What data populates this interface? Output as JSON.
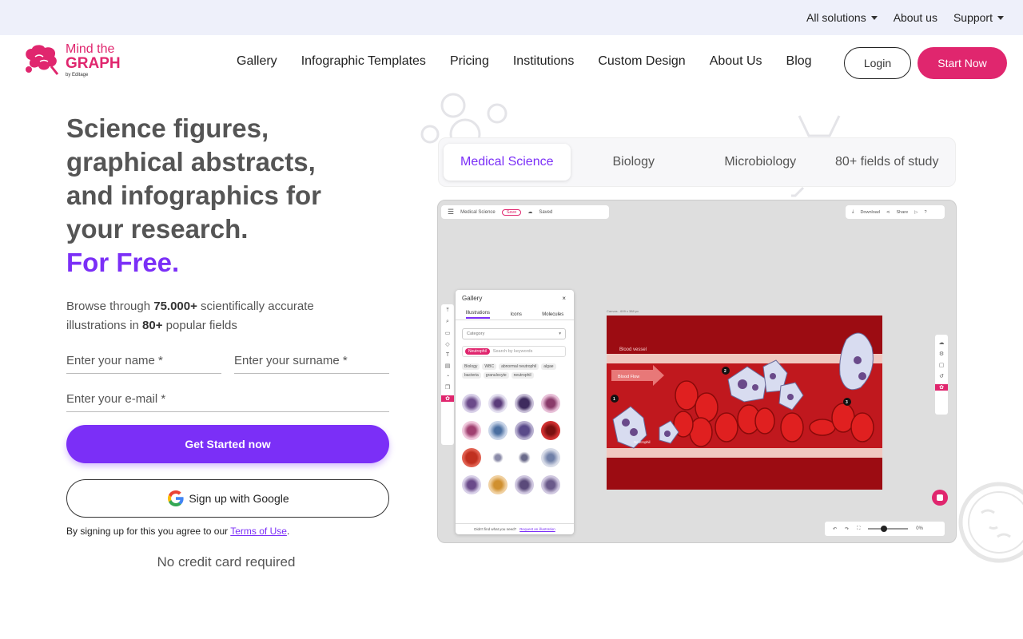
{
  "topbar": {
    "items": [
      {
        "label": "All solutions",
        "has_caret": true
      },
      {
        "label": "About us",
        "has_caret": false
      },
      {
        "label": "Support",
        "has_caret": true
      }
    ]
  },
  "logo": {
    "line1": "Mind the",
    "line2": "GRAPH",
    "line3": "by Editage"
  },
  "nav": {
    "items": [
      "Gallery",
      "Infographic Templates",
      "Pricing",
      "Institutions",
      "Custom Design",
      "About Us",
      "Blog"
    ],
    "login": "Login",
    "start": "Start Now"
  },
  "hero": {
    "title": "Science figures, graphical abstracts, and infographics for your research.",
    "free": "For Free.",
    "desc_pre": "Browse through ",
    "desc_count": "75.000+",
    "desc_mid": " scientifically accurate illustrations in ",
    "desc_fields": "80+",
    "desc_post": " popular fields"
  },
  "form": {
    "name_placeholder": "Enter your name *",
    "surname_placeholder": "Enter your surname *",
    "email_placeholder": "Enter your e-mail *",
    "submit": "Get Started now",
    "google": "Sign up with Google",
    "terms_pre": "By signing up for this you agree to our ",
    "terms_link": "Terms of Use",
    "terms_post": ".",
    "no_cc": "No credit card required"
  },
  "showcase": {
    "tabs": [
      {
        "label": "Medical Science",
        "active": true
      },
      {
        "label": "Biology",
        "active": false
      },
      {
        "label": "Microbiology",
        "active": false
      },
      {
        "label": "80+ fields of study",
        "active": false
      }
    ]
  },
  "editor": {
    "doc_name": "Medical Science",
    "save": "Save",
    "saved": "Saved",
    "download": "Download",
    "share": "Share",
    "gallery_title": "Gallery",
    "gallery_tabs": [
      "Illustrations",
      "Icons",
      "Molecules"
    ],
    "category": "Category",
    "chip": "Neutrophil",
    "search_placeholder": "Search by keywords",
    "tags": [
      "Biology",
      "WBC",
      "abnormal neutrophil",
      "algae",
      "bacteria",
      "granulocyte",
      "neutrophil"
    ],
    "footer_pre": "Didn't find what you need?",
    "footer_link": "Request an illustration",
    "canvas_label": "Canvas - 609 x 388 px",
    "canvas_texts": {
      "vessel": "Blood vessel",
      "flow": "Blood Flow",
      "neutrophil": "Neutrophil",
      "n1": "1",
      "n2": "2",
      "n3": "3"
    },
    "zoom": "0%"
  },
  "colors": {
    "brand_pink": "#e0266e",
    "brand_purple": "#7b2ff7",
    "topbar_bg": "#eef0fa"
  }
}
